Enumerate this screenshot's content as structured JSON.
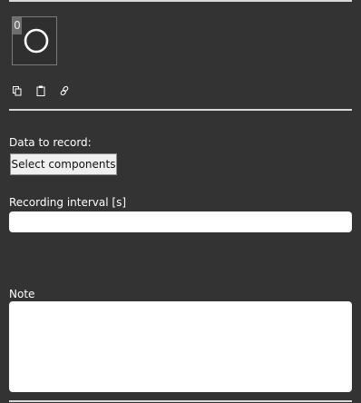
{
  "component": {
    "badge": "0",
    "icon": "circle-icon"
  },
  "toolbar": {
    "copy_icon": "copy-icon",
    "paste_icon": "clipboard-icon",
    "link_icon": "link-icon"
  },
  "form": {
    "data_label": "Data to record:",
    "select_button": "Select components",
    "interval_label": "Recording interval [s]",
    "interval_value": "",
    "note_label": "Note",
    "note_value": ""
  },
  "colors": {
    "background": "#333333",
    "divider": "#d8d8d8",
    "input_bg": "#ffffff",
    "button_bg": "#efefef"
  }
}
